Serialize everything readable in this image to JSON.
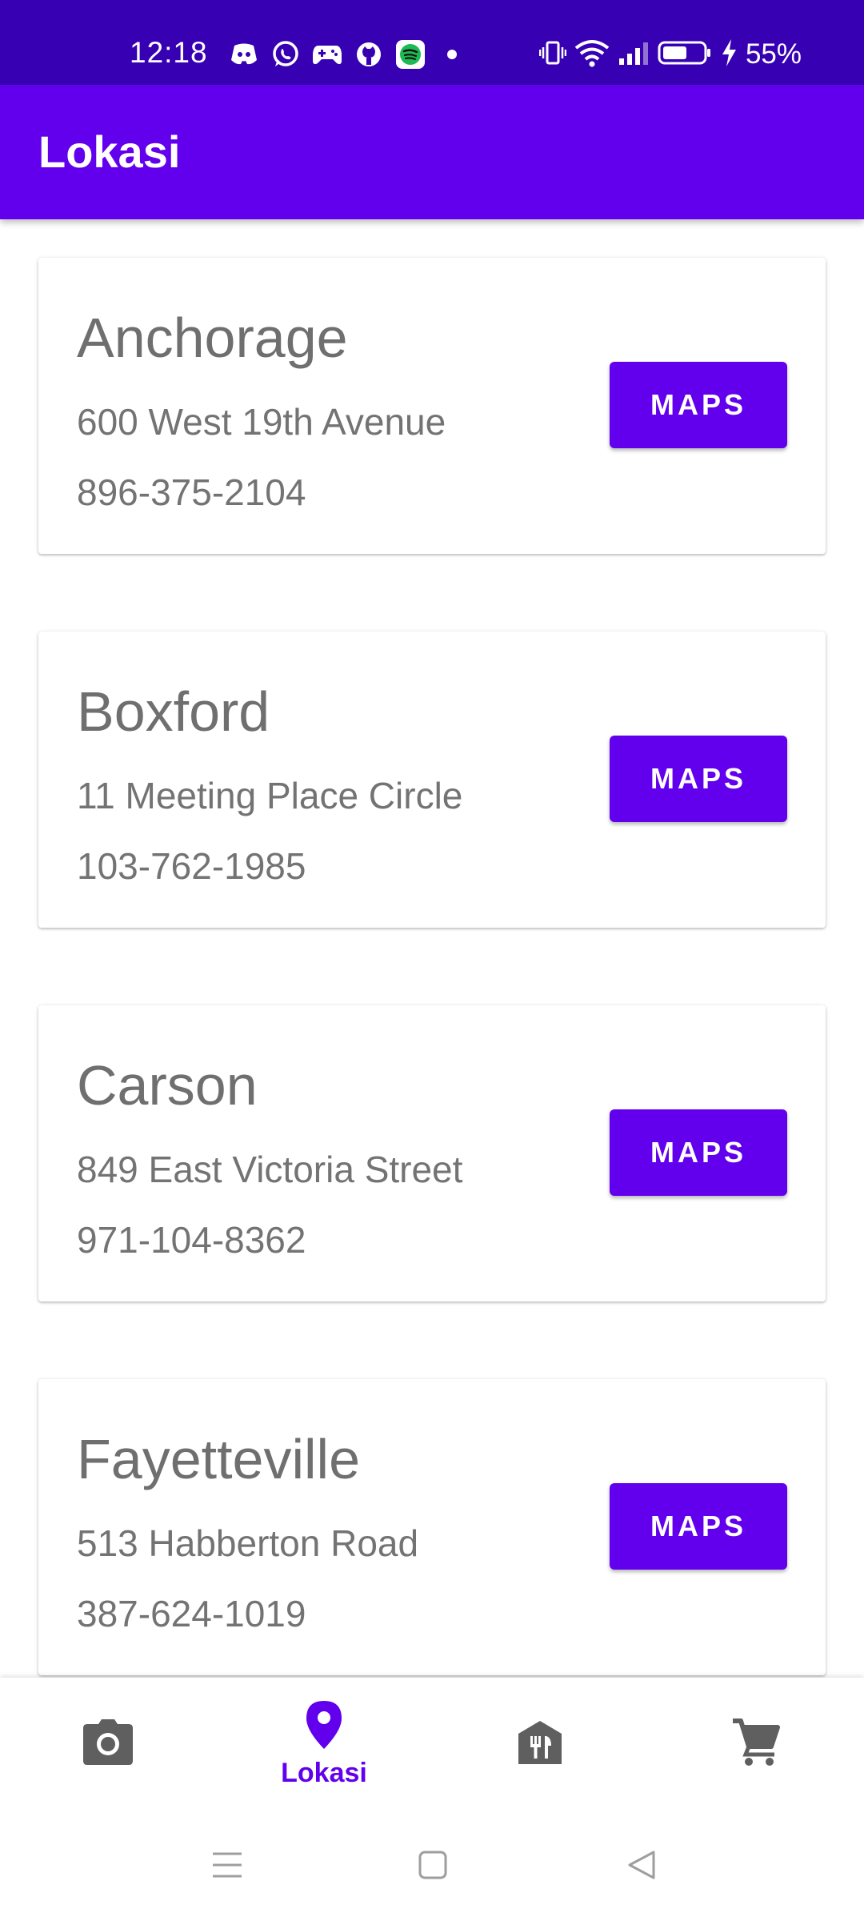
{
  "status_bar": {
    "time": "12:18",
    "battery": "55%",
    "notification_icons": [
      "discord-icon",
      "whatsapp-icon",
      "gamepad-icon",
      "github-icon",
      "spotify-icon",
      "dot-icon"
    ],
    "system_icons": [
      "vibrate-icon",
      "wifi-icon",
      "signal-icon",
      "battery-icon",
      "charging-icon"
    ]
  },
  "app_bar": {
    "title": "Lokasi"
  },
  "locations": [
    {
      "city": "Anchorage",
      "address": "600 West 19th Avenue",
      "phone": "896-375-2104",
      "button": "MAPS"
    },
    {
      "city": "Boxford",
      "address": "11 Meeting Place Circle",
      "phone": "103-762-1985",
      "button": "MAPS"
    },
    {
      "city": "Carson",
      "address": "849 East Victoria Street",
      "phone": "971-104-8362",
      "button": "MAPS"
    },
    {
      "city": "Fayetteville",
      "address": "513 Habberton Road",
      "phone": "387-624-1019",
      "button": "MAPS"
    }
  ],
  "bottom_nav": {
    "items": [
      {
        "icon": "camera-icon",
        "label": ""
      },
      {
        "icon": "location-pin-icon",
        "label": "Lokasi",
        "active": true
      },
      {
        "icon": "restaurant-icon",
        "label": ""
      },
      {
        "icon": "cart-icon",
        "label": ""
      }
    ]
  },
  "colors": {
    "status_bar": "#3700b3",
    "primary": "#6200ee",
    "text_secondary": "#737373",
    "icon_inactive": "#5f5f5f"
  }
}
